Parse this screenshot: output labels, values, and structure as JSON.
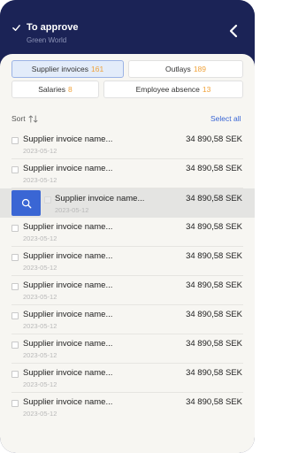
{
  "header": {
    "title": "To approve",
    "subtitle": "Green World"
  },
  "tabs": [
    {
      "label": "Supplier invoices",
      "count": "161",
      "active": true
    },
    {
      "label": "Outlays",
      "count": "189",
      "active": false
    },
    {
      "label": "Salaries",
      "count": "8",
      "active": false
    },
    {
      "label": "Employee absence",
      "count": "13",
      "active": false
    }
  ],
  "toolbar": {
    "sort_label": "Sort",
    "select_all_label": "Select all"
  },
  "rows": [
    {
      "name": "Supplier invoice name...",
      "date": "2023-05-12",
      "amount": "34 890,58 SEK"
    },
    {
      "name": "Supplier invoice name...",
      "date": "2023-05-12",
      "amount": "34 890,58 SEK"
    },
    {
      "name": "Supplier invoice name...",
      "date": "2023-05-12",
      "amount": "34 890,58 SEK"
    },
    {
      "name": "Supplier invoice name...",
      "date": "2023-05-12",
      "amount": "34 890,58 SEK"
    },
    {
      "name": "Supplier invoice name...",
      "date": "2023-05-12",
      "amount": "34 890,58 SEK"
    },
    {
      "name": "Supplier invoice name...",
      "date": "2023-05-12",
      "amount": "34 890,58 SEK"
    },
    {
      "name": "Supplier invoice name...",
      "date": "2023-05-12",
      "amount": "34 890,58 SEK"
    },
    {
      "name": "Supplier invoice name...",
      "date": "2023-05-12",
      "amount": "34 890,58 SEK"
    },
    {
      "name": "Supplier invoice name...",
      "date": "2023-05-12",
      "amount": "34 890,58 SEK"
    },
    {
      "name": "Supplier invoice name...",
      "date": "2023-05-12",
      "amount": "34 890,58 SEK"
    }
  ],
  "colors": {
    "header_bg": "#1b2356",
    "accent_blue": "#3a66d4",
    "count_orange": "#f0a23a",
    "sheet_bg": "#f7f6f2"
  },
  "icons": {
    "header_check": "check-icon",
    "back": "chevron-left-icon",
    "sort": "sort-arrows-icon",
    "swipe_action": "search-icon"
  }
}
